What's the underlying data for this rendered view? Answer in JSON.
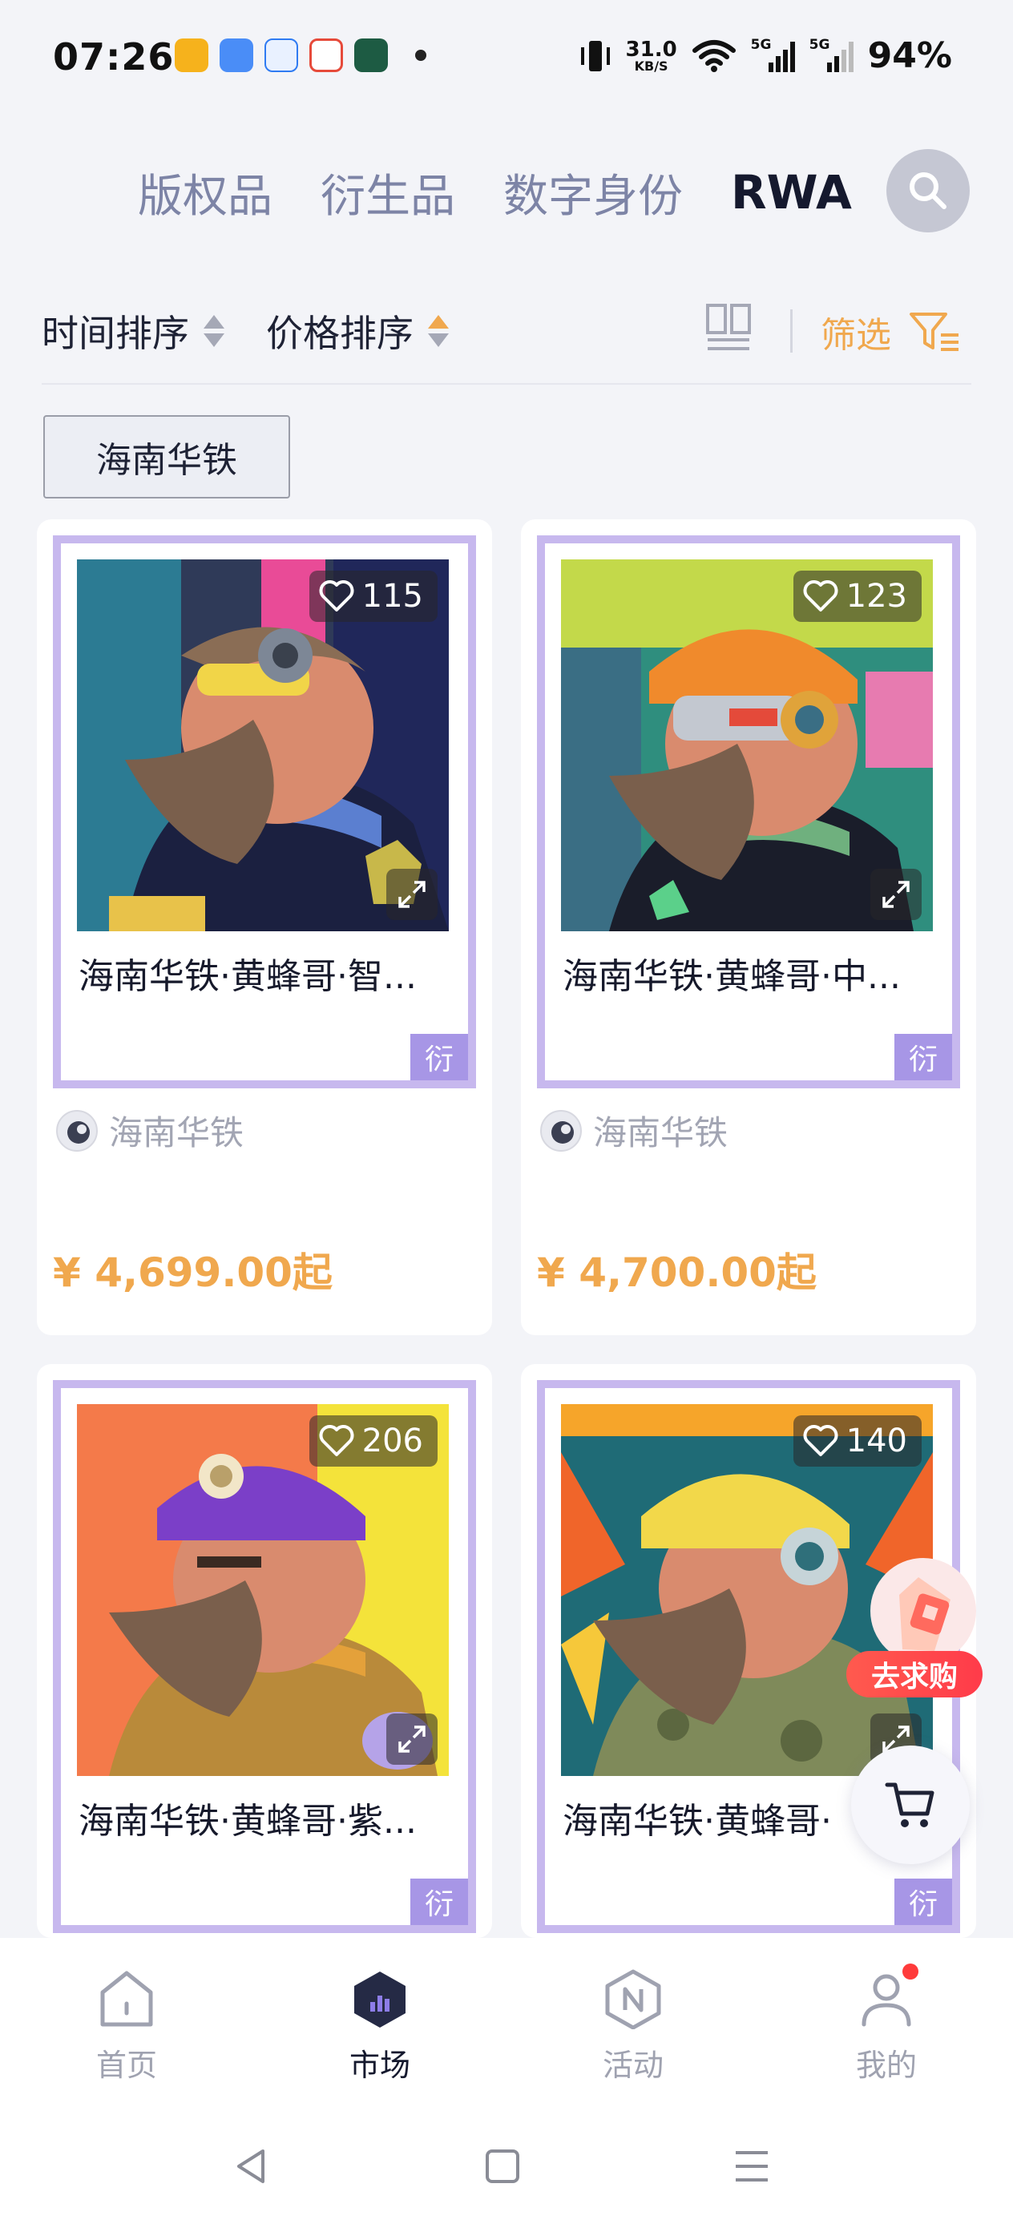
{
  "status_bar": {
    "time": "07:26",
    "net_speed_value": "31.0",
    "net_speed_unit": "KB/S",
    "signal_1": "5G",
    "signal_2": "5G",
    "battery": "94%"
  },
  "category_tabs": [
    {
      "label": "版权品",
      "active": false
    },
    {
      "label": "衍生品",
      "active": false
    },
    {
      "label": "数字身份",
      "active": false
    },
    {
      "label": "RWA",
      "active": true
    }
  ],
  "sort_bar": {
    "time_sort": "时间排序",
    "price_sort": "价格排序",
    "filter_label": "筛选"
  },
  "brand_chip": "海南华铁",
  "products": [
    {
      "likes": "115",
      "name": "海南华铁·黄蜂哥·智...",
      "tag": "衍",
      "creator": "海南华铁",
      "price": "¥ 4,699.00起"
    },
    {
      "likes": "123",
      "name": "海南华铁·黄蜂哥·中...",
      "tag": "衍",
      "creator": "海南华铁",
      "price": "¥ 4,700.00起"
    },
    {
      "likes": "206",
      "name": "海南华铁·黄蜂哥·紫...",
      "tag": "衍",
      "creator": "",
      "price": ""
    },
    {
      "likes": "140",
      "name": "海南华铁·黄蜂哥·",
      "tag": "衍",
      "creator": "",
      "price": ""
    }
  ],
  "floating": {
    "want_to_buy": "去求购"
  },
  "bottom_nav": [
    {
      "label": "首页",
      "icon": "home-icon",
      "active": false
    },
    {
      "label": "市场",
      "icon": "market-icon",
      "active": true
    },
    {
      "label": "活动",
      "icon": "activity-icon",
      "active": false
    },
    {
      "label": "我的",
      "icon": "profile-icon",
      "active": false
    }
  ],
  "colors": {
    "accent_orange": "#f0a84e",
    "card_frame": "#c7b8ee",
    "tag_purple": "#a796e6",
    "active_text": "#15192e",
    "inactive_text": "#7d84a6"
  }
}
